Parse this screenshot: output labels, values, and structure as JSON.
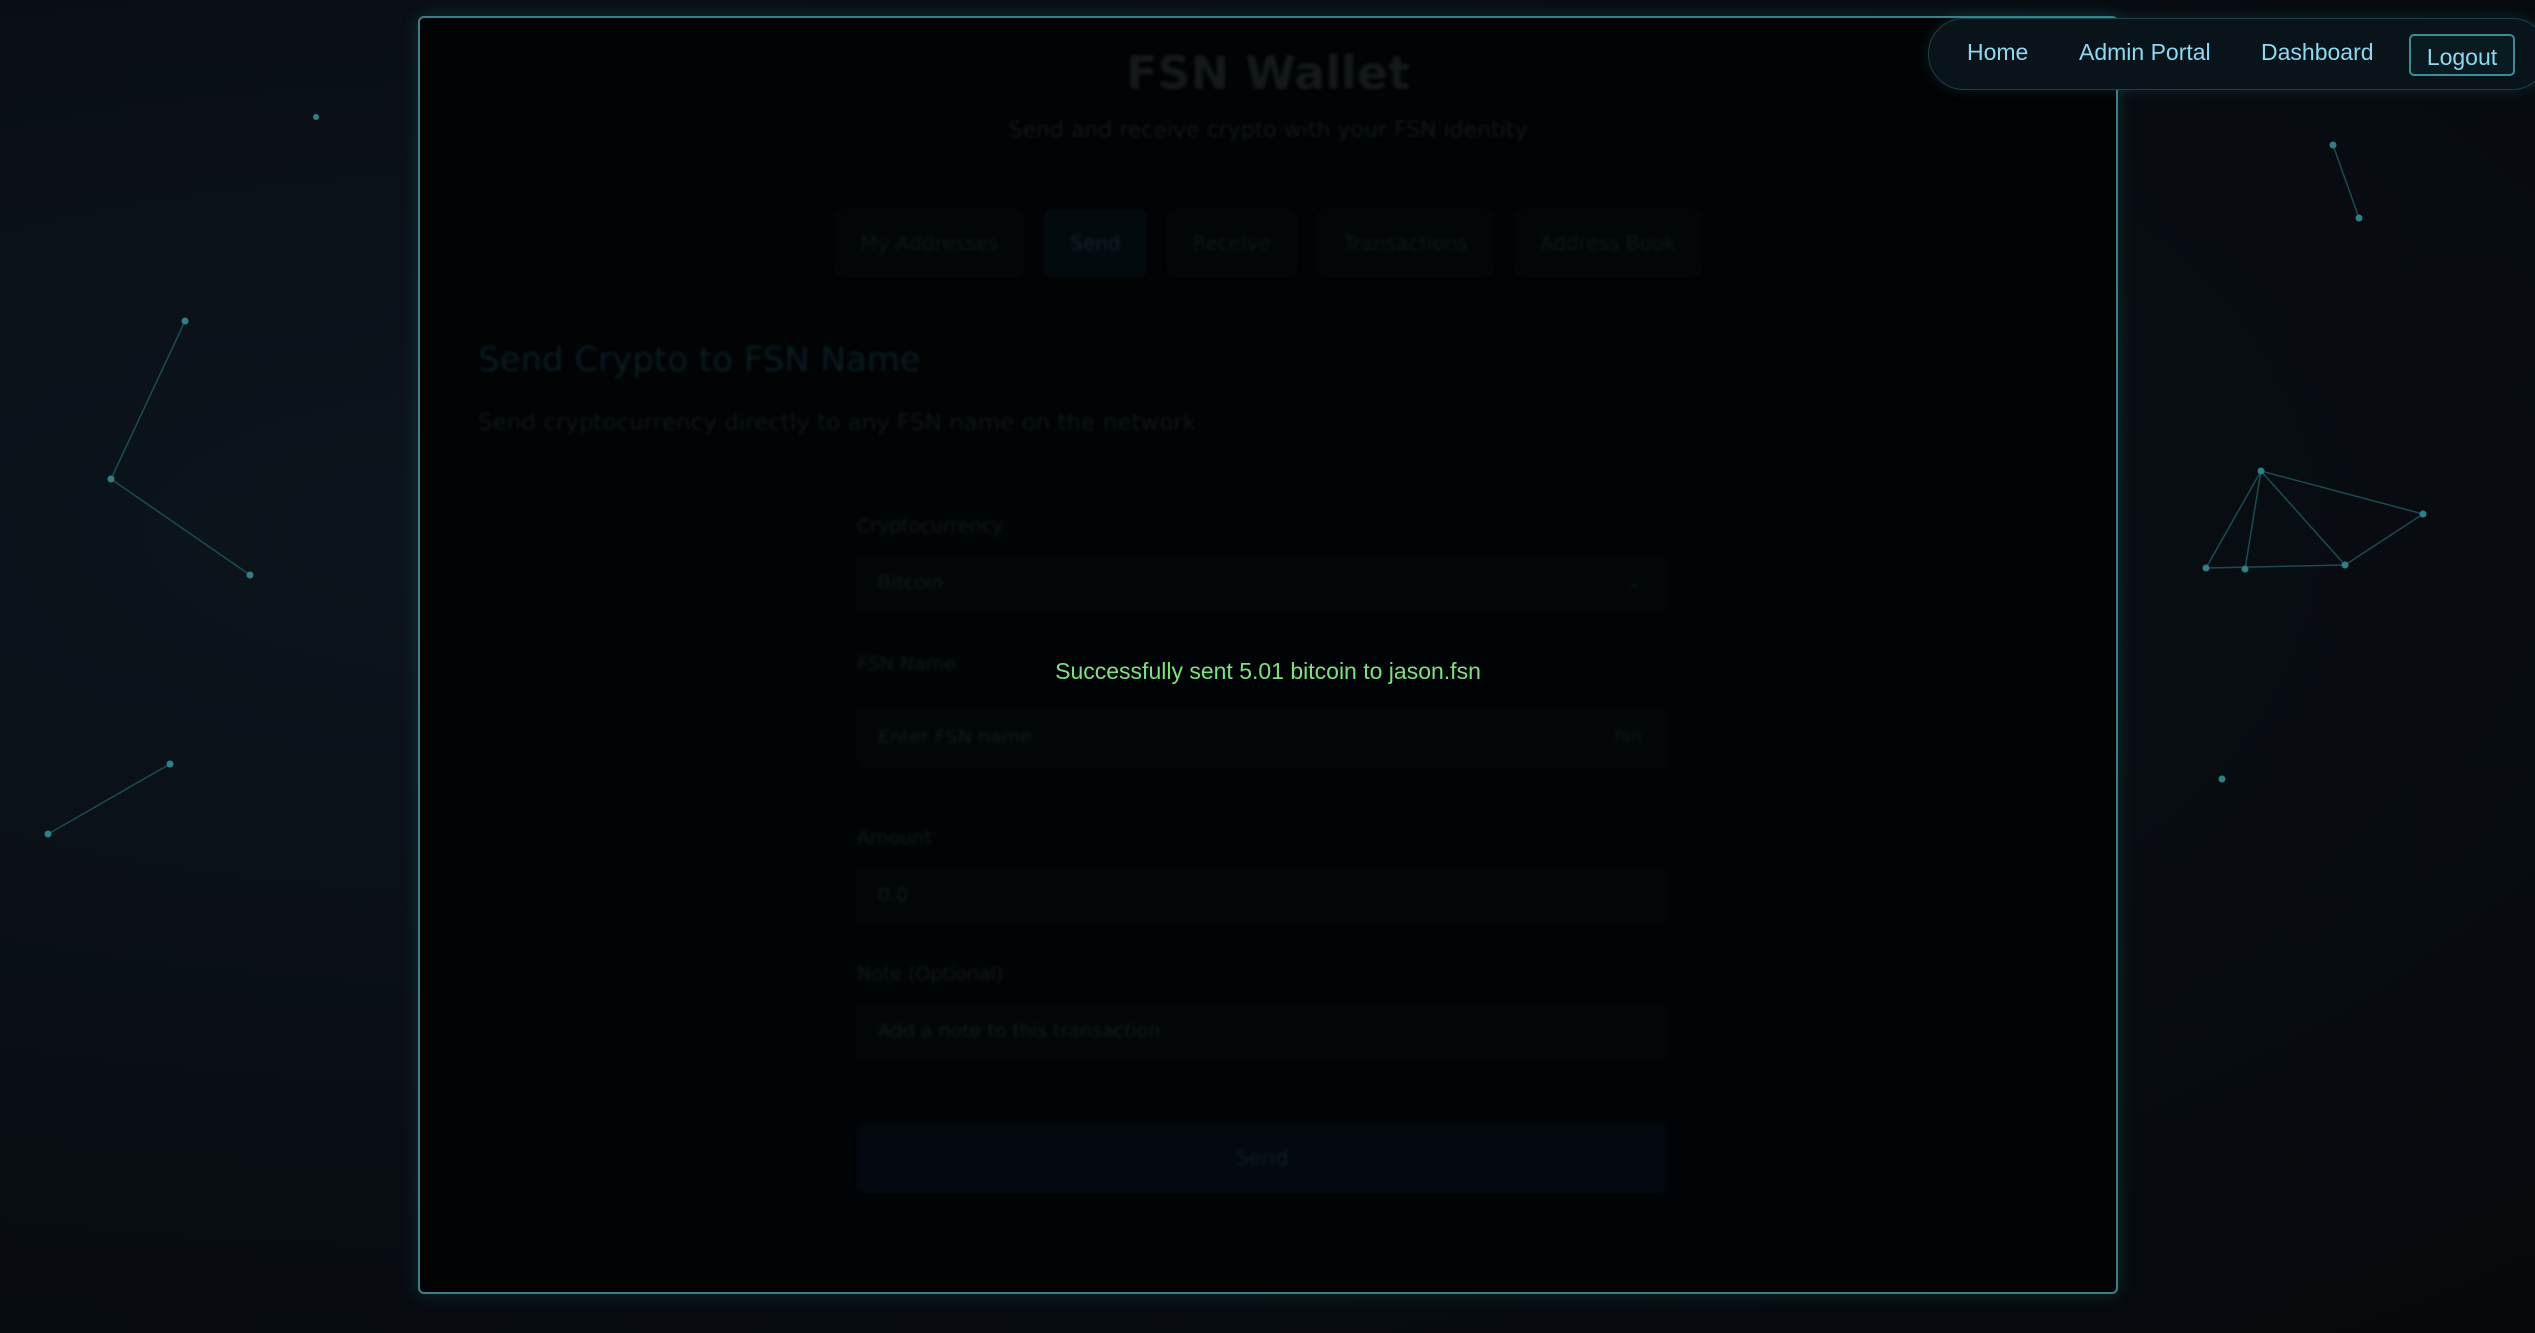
{
  "nav": {
    "home": "Home",
    "admin_portal": "Admin Portal",
    "dashboard": "Dashboard",
    "logout": "Logout"
  },
  "wallet": {
    "title": "FSN Wallet",
    "subtitle": "Send and receive crypto with your FSN identity",
    "tabs": [
      {
        "label": "My Addresses"
      },
      {
        "label": "Send",
        "active": true
      },
      {
        "label": "Receive"
      },
      {
        "label": "Transactions"
      },
      {
        "label": "Address Book"
      }
    ],
    "section_title": "Send Crypto to FSN Name",
    "section_description": "Send cryptocurrency directly to any FSN name on the network"
  },
  "form": {
    "currency_label": "Cryptocurrency",
    "currency_value": "Bitcoin",
    "recipient_label": "FSN Name",
    "recipient_placeholder": "Enter FSN name",
    "recipient_suffix": ".fsn",
    "amount_label": "Amount",
    "amount_placeholder": "0.0",
    "note_label": "Note (Optional)",
    "note_placeholder": "Add a note to this transaction",
    "submit_label": "Send"
  },
  "toast": {
    "message": "Successfully sent 5.01 bitcoin to jason.fsn",
    "color": "#7fe07f"
  },
  "colors": {
    "accent": "#3b7f86",
    "nav_text": "#8fd8f0"
  }
}
